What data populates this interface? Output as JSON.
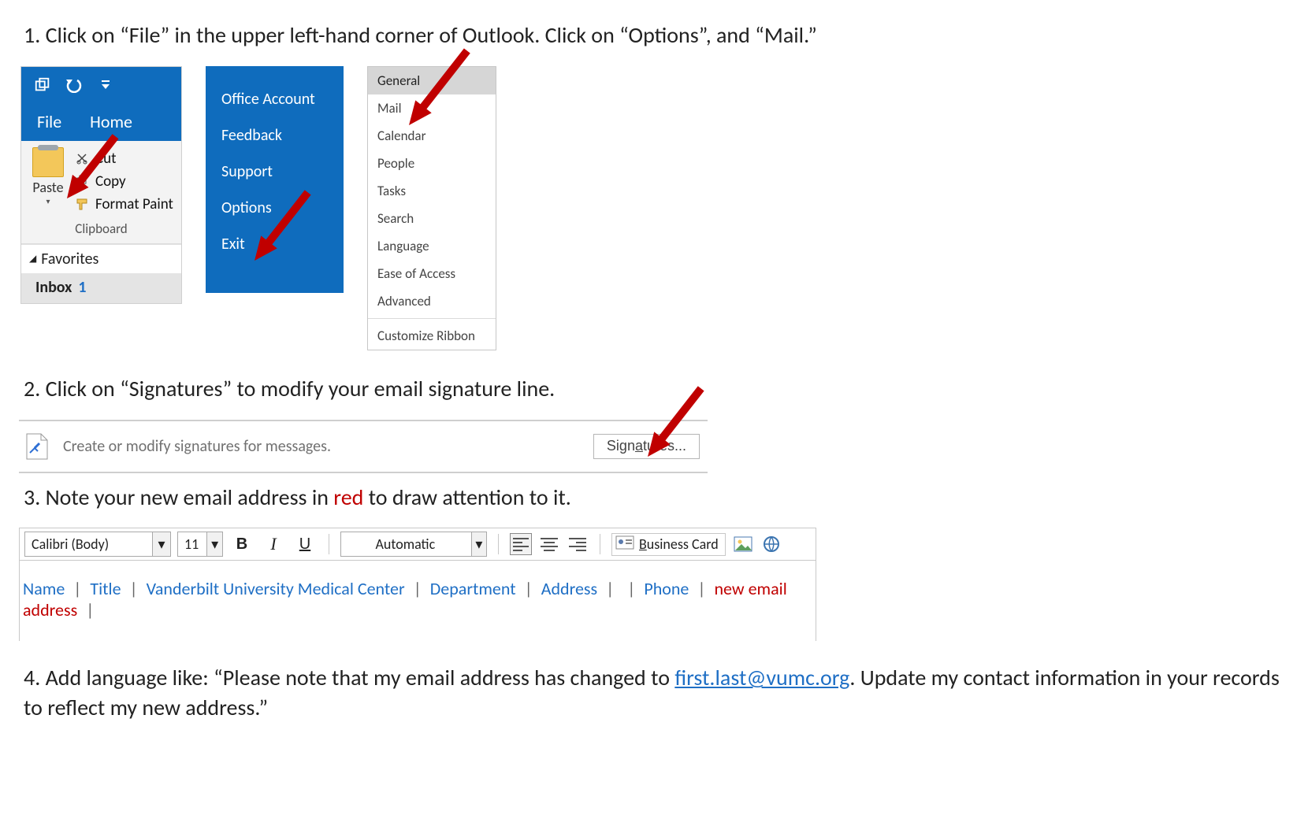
{
  "steps": {
    "s1": "1. Click on “File” in the upper left-hand corner of Outlook. Click on “Options”, and “Mail.”",
    "s2": "2. Click on “Signatures” to modify your email signature line.",
    "s3_prefix": "3. Note your new email address in ",
    "s3_red": "red",
    "s3_suffix": " to draw attention to it.",
    "s4_prefix": "4. Add language like: “Please note that my email address has changed to ",
    "s4_link": "first.last@vumc.org",
    "s4_suffix": ". Update my contact information in your records to reflect my new address.”"
  },
  "ribbon": {
    "tab_file": "File",
    "tab_home": "Home",
    "paste": "Paste",
    "cut": "Cut",
    "copy": "Copy",
    "format_painter": "Format Paint",
    "clipboard": "Clipboard",
    "favorites": "Favorites",
    "inbox": "Inbox",
    "inbox_count": "1"
  },
  "bluemenu": {
    "office_account": "Office Account",
    "feedback": "Feedback",
    "support": "Support",
    "options": "Options",
    "exit": "Exit"
  },
  "options_categories": {
    "general": "General",
    "mail": "Mail",
    "calendar": "Calendar",
    "people": "People",
    "tasks": "Tasks",
    "search": "Search",
    "language": "Language",
    "ease": "Ease of Access",
    "advanced": "Advanced",
    "customize": "Customize Ribbon"
  },
  "signatures_row": {
    "desc": "Create or modify signatures for messages.",
    "button_prefix": "Sign",
    "button_ul": "a",
    "button_suffix": "tures..."
  },
  "editor": {
    "font": "Calibri (Body)",
    "size": "11",
    "bold": "B",
    "italic": "I",
    "underline": "U",
    "color": "Automatic",
    "business_card_prefix": "",
    "business_card_ul": "B",
    "business_card_suffix": "usiness Card"
  },
  "signature_line": {
    "name": "Name",
    "title": "Title",
    "org": "Vanderbilt University Medical Center",
    "dept": "Department",
    "address": "Address",
    "phone": "Phone",
    "new_email": "new email address"
  }
}
